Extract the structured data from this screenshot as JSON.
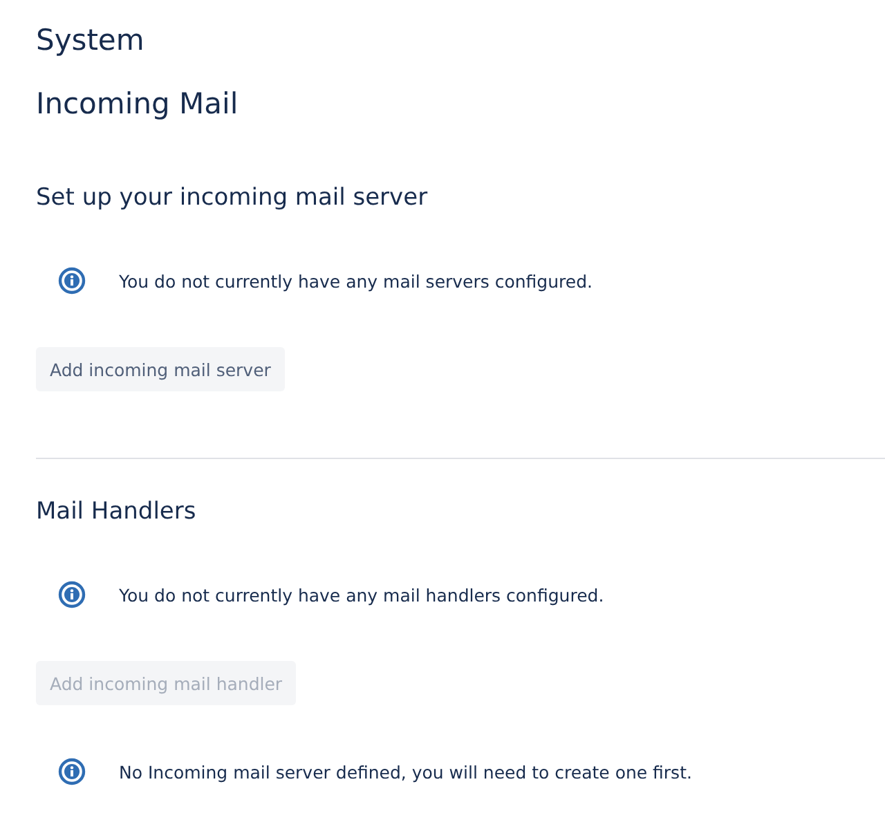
{
  "breadcrumb": "System",
  "page_title": "Incoming Mail",
  "sections": [
    {
      "heading": "Set up your incoming mail server",
      "items": [
        {
          "kind": "info",
          "text": "You do not currently have any mail servers configured."
        },
        {
          "kind": "button",
          "label": "Add incoming mail server",
          "disabled": false
        }
      ]
    },
    {
      "heading": "Mail Handlers",
      "items": [
        {
          "kind": "info",
          "text": "You do not currently have any mail handlers configured."
        },
        {
          "kind": "button",
          "label": "Add incoming mail handler",
          "disabled": true
        },
        {
          "kind": "info",
          "text": "No Incoming mail server defined, you will need to create one first."
        }
      ]
    }
  ]
}
